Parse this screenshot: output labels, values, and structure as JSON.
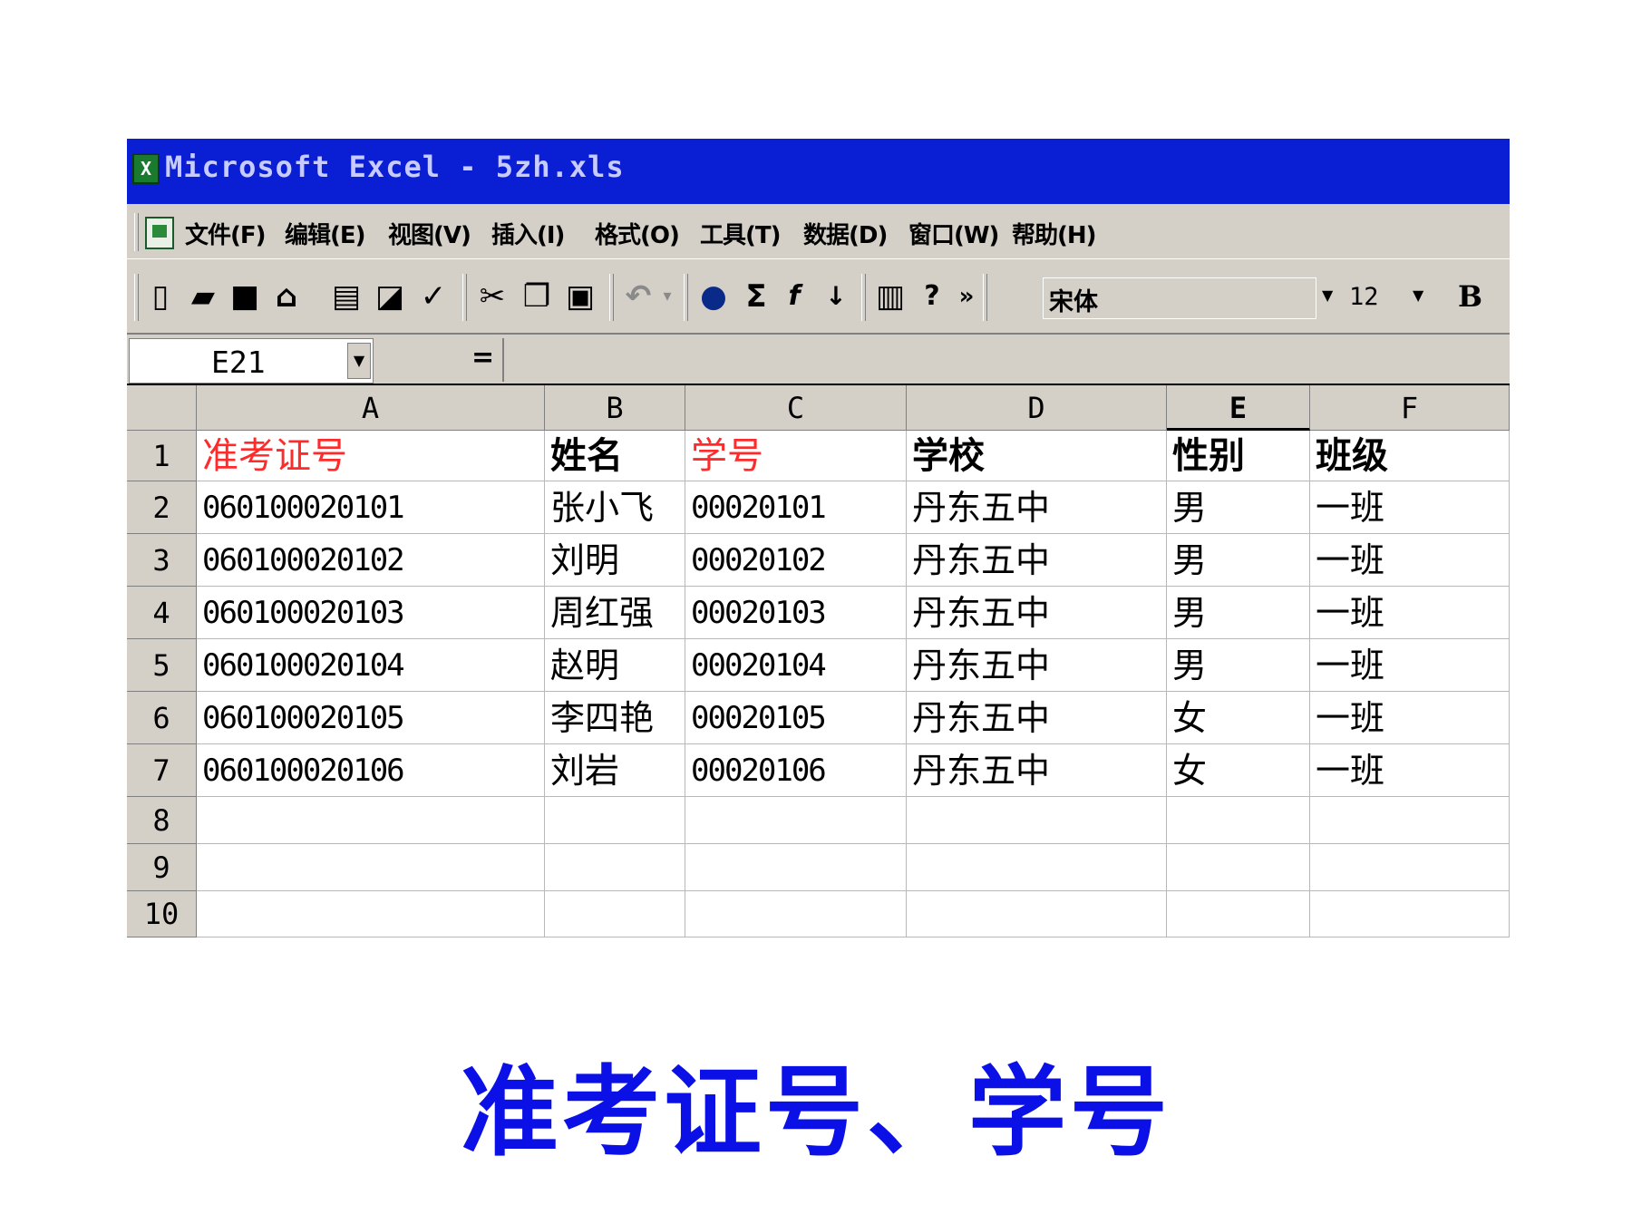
{
  "window": {
    "title": "Microsoft Excel - 5zh.xls",
    "app_icon": "excel-icon"
  },
  "menu": [
    "文件(F)",
    "编辑(E)",
    "视图(V)",
    "插入(I)",
    "格式(O)",
    "工具(T)",
    "数据(D)",
    "窗口(W)",
    "帮助(H)"
  ],
  "toolbar": {
    "font_name": "宋体",
    "font_size": "12",
    "bold_label": "B"
  },
  "formula_bar": {
    "name_box": "E21",
    "equals": "=",
    "formula": ""
  },
  "sheet": {
    "columns": [
      "A",
      "B",
      "C",
      "D",
      "E",
      "F"
    ],
    "rows": [
      "1",
      "2",
      "3",
      "4",
      "5",
      "6",
      "7",
      "8",
      "9",
      "10"
    ],
    "header": [
      "准考证号",
      "姓名",
      "学号",
      "学校",
      "性别",
      "班级"
    ],
    "data": [
      [
        "060100020101",
        "张小飞",
        "00020101",
        "丹东五中",
        "男",
        "一班"
      ],
      [
        "060100020102",
        "刘明",
        "00020102",
        "丹东五中",
        "男",
        "一班"
      ],
      [
        "060100020103",
        "周红强",
        "00020103",
        "丹东五中",
        "男",
        "一班"
      ],
      [
        "060100020104",
        "赵明",
        "00020104",
        "丹东五中",
        "男",
        "一班"
      ],
      [
        "060100020105",
        "李四艳",
        "00020105",
        "丹东五中",
        "女",
        "一班"
      ],
      [
        "060100020106",
        "刘岩",
        "00020106",
        "丹东五中",
        "女",
        "一班"
      ]
    ],
    "highlight_color": "#ff2a2a"
  },
  "caption": "准考证号、学号",
  "colors": {
    "titlebar": "#0a1fd4",
    "caption": "#0a10e6",
    "chrome": "#d4d0c8"
  }
}
